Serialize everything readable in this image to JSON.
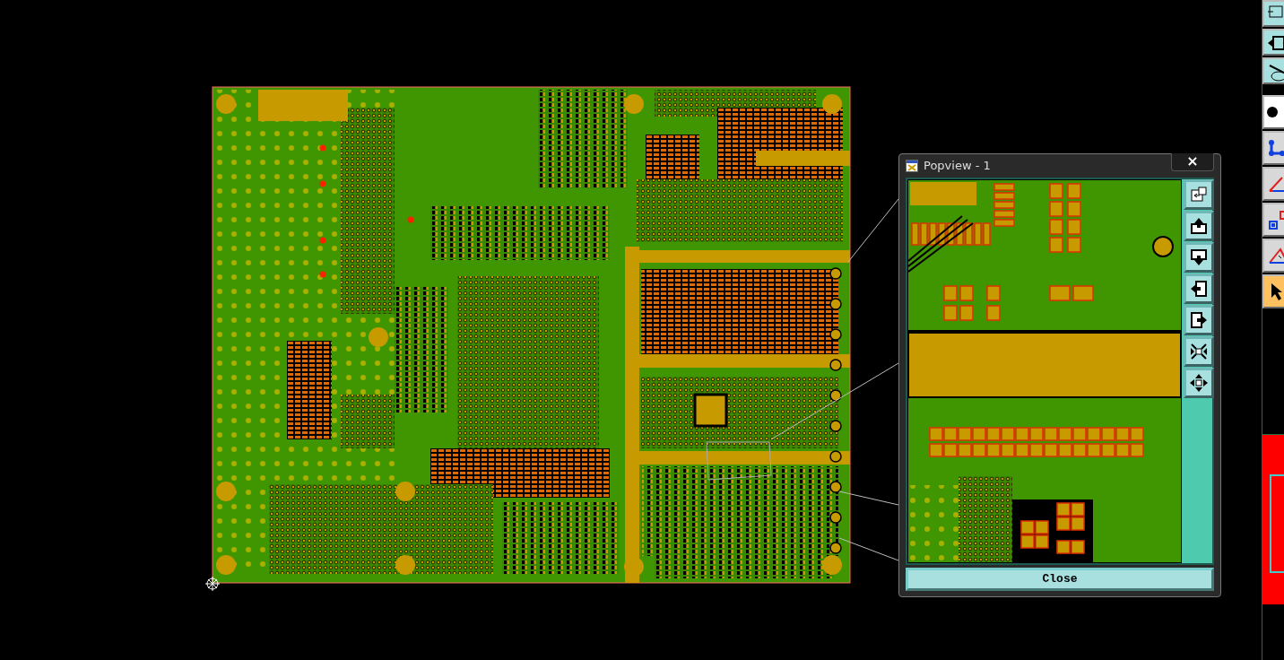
{
  "popview": {
    "title": "Popview - 1",
    "close_glyph": "×",
    "close_button": "Close"
  },
  "right_toolbar": {
    "tools": [
      {
        "selected": false
      },
      {
        "selected": false
      },
      {
        "selected": false
      },
      {
        "selected": false
      },
      {
        "selected": false
      },
      {
        "selected": false
      },
      {
        "selected": false
      },
      {
        "selected": false
      },
      {
        "selected": true
      }
    ]
  }
}
